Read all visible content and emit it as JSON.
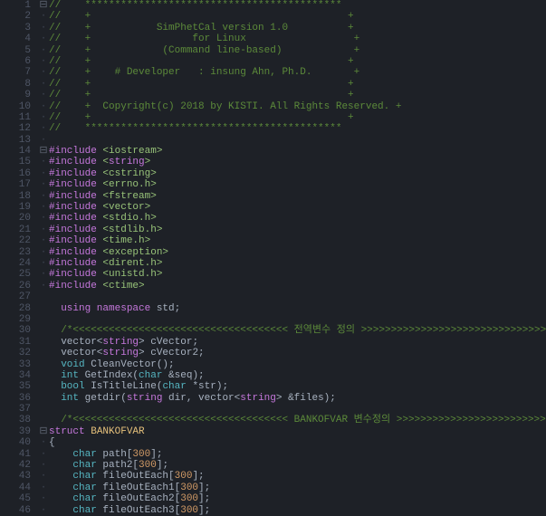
{
  "lines": [
    {
      "n": 1,
      "fold": "⊟",
      "guide": "",
      "tokens": [
        {
          "t": "//    *******************************************",
          "c": "c-comment"
        }
      ]
    },
    {
      "n": 2,
      "fold": "",
      "guide": "|",
      "tokens": [
        {
          "t": "//    +                                           +",
          "c": "c-comment"
        }
      ]
    },
    {
      "n": 3,
      "fold": "",
      "guide": "|",
      "tokens": [
        {
          "t": "//    +           SimPhetCal version 1.0          +",
          "c": "c-comment"
        }
      ]
    },
    {
      "n": 4,
      "fold": "",
      "guide": "|",
      "tokens": [
        {
          "t": "//    +                 for Linux                  +",
          "c": "c-comment"
        }
      ]
    },
    {
      "n": 5,
      "fold": "",
      "guide": "|",
      "tokens": [
        {
          "t": "//    +            (Command line-based)            +",
          "c": "c-comment"
        }
      ]
    },
    {
      "n": 6,
      "fold": "",
      "guide": "|",
      "tokens": [
        {
          "t": "//    +                                           +",
          "c": "c-comment"
        }
      ]
    },
    {
      "n": 7,
      "fold": "",
      "guide": "|",
      "tokens": [
        {
          "t": "//    +    # Developer   : insung Ahn, Ph.D.       +",
          "c": "c-comment"
        }
      ]
    },
    {
      "n": 8,
      "fold": "",
      "guide": "|",
      "tokens": [
        {
          "t": "//    +                                           +",
          "c": "c-comment"
        }
      ]
    },
    {
      "n": 9,
      "fold": "",
      "guide": "|",
      "tokens": [
        {
          "t": "//    +                                           +",
          "c": "c-comment"
        }
      ]
    },
    {
      "n": 10,
      "fold": "",
      "guide": "|",
      "tokens": [
        {
          "t": "//    +  Copyright(c) 2018 by KISTI. All Rights Reserved. +",
          "c": "c-comment"
        }
      ]
    },
    {
      "n": 11,
      "fold": "",
      "guide": "|",
      "tokens": [
        {
          "t": "//    +                                           +",
          "c": "c-comment"
        }
      ]
    },
    {
      "n": 12,
      "fold": "",
      "guide": "|",
      "tokens": [
        {
          "t": "//    *******************************************",
          "c": "c-comment"
        }
      ]
    },
    {
      "n": 13,
      "fold": "",
      "guide": "|",
      "tokens": []
    },
    {
      "n": 14,
      "fold": "⊟",
      "guide": "",
      "tokens": [
        {
          "t": "#include ",
          "c": "c-pp"
        },
        {
          "t": "<iostream>",
          "c": "c-str"
        }
      ]
    },
    {
      "n": 15,
      "fold": "",
      "guide": "|",
      "tokens": [
        {
          "t": "#include ",
          "c": "c-pp"
        },
        {
          "t": "<",
          "c": "c-str"
        },
        {
          "t": "string",
          "c": "c-kw"
        },
        {
          "t": ">",
          "c": "c-str"
        }
      ]
    },
    {
      "n": 16,
      "fold": "",
      "guide": "|",
      "tokens": [
        {
          "t": "#include ",
          "c": "c-pp"
        },
        {
          "t": "<cstring>",
          "c": "c-str"
        }
      ]
    },
    {
      "n": 17,
      "fold": "",
      "guide": "|",
      "tokens": [
        {
          "t": "#include ",
          "c": "c-pp"
        },
        {
          "t": "<errno.h>",
          "c": "c-str"
        }
      ]
    },
    {
      "n": 18,
      "fold": "",
      "guide": "|",
      "tokens": [
        {
          "t": "#include ",
          "c": "c-pp"
        },
        {
          "t": "<fstream>",
          "c": "c-str"
        }
      ]
    },
    {
      "n": 19,
      "fold": "",
      "guide": "|",
      "tokens": [
        {
          "t": "#include ",
          "c": "c-pp"
        },
        {
          "t": "<vector>",
          "c": "c-str"
        }
      ]
    },
    {
      "n": 20,
      "fold": "",
      "guide": "|",
      "tokens": [
        {
          "t": "#include ",
          "c": "c-pp"
        },
        {
          "t": "<stdio.h>",
          "c": "c-str"
        }
      ]
    },
    {
      "n": 21,
      "fold": "",
      "guide": "|",
      "tokens": [
        {
          "t": "#include ",
          "c": "c-pp"
        },
        {
          "t": "<stdlib.h>",
          "c": "c-str"
        }
      ]
    },
    {
      "n": 22,
      "fold": "",
      "guide": "|",
      "tokens": [
        {
          "t": "#include ",
          "c": "c-pp"
        },
        {
          "t": "<time.h>",
          "c": "c-str"
        }
      ]
    },
    {
      "n": 23,
      "fold": "",
      "guide": "|",
      "tokens": [
        {
          "t": "#include ",
          "c": "c-pp"
        },
        {
          "t": "<exception>",
          "c": "c-str"
        }
      ]
    },
    {
      "n": 24,
      "fold": "",
      "guide": "|",
      "tokens": [
        {
          "t": "#include ",
          "c": "c-pp"
        },
        {
          "t": "<dirent.h>",
          "c": "c-str"
        }
      ]
    },
    {
      "n": 25,
      "fold": "",
      "guide": "|",
      "tokens": [
        {
          "t": "#include ",
          "c": "c-pp"
        },
        {
          "t": "<unistd.h>",
          "c": "c-str"
        }
      ]
    },
    {
      "n": 26,
      "fold": "",
      "guide": "|",
      "tokens": [
        {
          "t": "#include ",
          "c": "c-pp"
        },
        {
          "t": "<ctime>",
          "c": "c-str"
        }
      ]
    },
    {
      "n": 27,
      "fold": "",
      "guide": "",
      "tokens": []
    },
    {
      "n": 28,
      "fold": "",
      "guide": "",
      "tokens": [
        {
          "t": "  ",
          "c": ""
        },
        {
          "t": "using namespace",
          "c": "c-kw"
        },
        {
          "t": " std;",
          "c": "c-ident"
        }
      ]
    },
    {
      "n": 29,
      "fold": "",
      "guide": "",
      "tokens": []
    },
    {
      "n": 30,
      "fold": "",
      "guide": "",
      "tokens": [
        {
          "t": "  ",
          "c": ""
        },
        {
          "t": "/*<<<<<<<<<<<<<<<<<<<<<<<<<<<<<<<<<<<< 전역변수 정의 >>>>>>>>>>>>>>>>>>>>>>>>>>>>>>>>>>>>*/",
          "c": "c-comment"
        }
      ]
    },
    {
      "n": 31,
      "fold": "",
      "guide": "",
      "tokens": [
        {
          "t": "  vector<",
          "c": "c-ident"
        },
        {
          "t": "string",
          "c": "c-kw"
        },
        {
          "t": "> cVector;",
          "c": "c-ident"
        }
      ]
    },
    {
      "n": 32,
      "fold": "",
      "guide": "",
      "tokens": [
        {
          "t": "  vector<",
          "c": "c-ident"
        },
        {
          "t": "string",
          "c": "c-kw"
        },
        {
          "t": "> cVector2;",
          "c": "c-ident"
        }
      ]
    },
    {
      "n": 33,
      "fold": "",
      "guide": "",
      "tokens": [
        {
          "t": "  ",
          "c": ""
        },
        {
          "t": "void",
          "c": "c-type"
        },
        {
          "t": " CleanVector();",
          "c": "c-ident"
        }
      ]
    },
    {
      "n": 34,
      "fold": "",
      "guide": "",
      "tokens": [
        {
          "t": "  ",
          "c": ""
        },
        {
          "t": "int",
          "c": "c-type"
        },
        {
          "t": " GetIndex(",
          "c": "c-ident"
        },
        {
          "t": "char",
          "c": "c-type"
        },
        {
          "t": " &seq);",
          "c": "c-ident"
        }
      ]
    },
    {
      "n": 35,
      "fold": "",
      "guide": "",
      "tokens": [
        {
          "t": "  ",
          "c": ""
        },
        {
          "t": "bool",
          "c": "c-type"
        },
        {
          "t": " IsTitleLine(",
          "c": "c-ident"
        },
        {
          "t": "char",
          "c": "c-type"
        },
        {
          "t": " *str);",
          "c": "c-ident"
        }
      ]
    },
    {
      "n": 36,
      "fold": "",
      "guide": "",
      "tokens": [
        {
          "t": "  ",
          "c": ""
        },
        {
          "t": "int",
          "c": "c-type"
        },
        {
          "t": " getdir(",
          "c": "c-ident"
        },
        {
          "t": "string",
          "c": "c-kw"
        },
        {
          "t": " dir, vector<",
          "c": "c-ident"
        },
        {
          "t": "string",
          "c": "c-kw"
        },
        {
          "t": "> &files);",
          "c": "c-ident"
        }
      ]
    },
    {
      "n": 37,
      "fold": "",
      "guide": "",
      "tokens": []
    },
    {
      "n": 38,
      "fold": "",
      "guide": "",
      "tokens": [
        {
          "t": "  ",
          "c": ""
        },
        {
          "t": "/*<<<<<<<<<<<<<<<<<<<<<<<<<<<<<<<<<<<< BANKOFVAR 변수정의 >>>>>>>>>>>>>>>>>>>>>>>>>>>>>>>>>>>>*/",
          "c": "c-comment"
        }
      ]
    },
    {
      "n": 39,
      "fold": "⊟",
      "guide": "",
      "tokens": [
        {
          "t": "struct",
          "c": "c-kw"
        },
        {
          "t": " ",
          "c": ""
        },
        {
          "t": "BANKOFVAR",
          "c": "c-name"
        }
      ]
    },
    {
      "n": 40,
      "fold": "",
      "guide": "|",
      "tokens": [
        {
          "t": "{",
          "c": "c-punc"
        }
      ]
    },
    {
      "n": 41,
      "fold": "",
      "guide": "|",
      "tokens": [
        {
          "t": "    ",
          "c": ""
        },
        {
          "t": "char",
          "c": "c-type"
        },
        {
          "t": " path[",
          "c": "c-ident"
        },
        {
          "t": "300",
          "c": "c-num"
        },
        {
          "t": "];",
          "c": "c-ident"
        }
      ]
    },
    {
      "n": 42,
      "fold": "",
      "guide": "|",
      "tokens": [
        {
          "t": "    ",
          "c": ""
        },
        {
          "t": "char",
          "c": "c-type"
        },
        {
          "t": " path2[",
          "c": "c-ident"
        },
        {
          "t": "300",
          "c": "c-num"
        },
        {
          "t": "];",
          "c": "c-ident"
        }
      ]
    },
    {
      "n": 43,
      "fold": "",
      "guide": "|",
      "tokens": [
        {
          "t": "    ",
          "c": ""
        },
        {
          "t": "char",
          "c": "c-type"
        },
        {
          "t": " fileOutEach[",
          "c": "c-ident"
        },
        {
          "t": "300",
          "c": "c-num"
        },
        {
          "t": "];",
          "c": "c-ident"
        }
      ]
    },
    {
      "n": 44,
      "fold": "",
      "guide": "|",
      "tokens": [
        {
          "t": "    ",
          "c": ""
        },
        {
          "t": "char",
          "c": "c-type"
        },
        {
          "t": " fileOutEach1[",
          "c": "c-ident"
        },
        {
          "t": "300",
          "c": "c-num"
        },
        {
          "t": "];",
          "c": "c-ident"
        }
      ]
    },
    {
      "n": 45,
      "fold": "",
      "guide": "|",
      "tokens": [
        {
          "t": "    ",
          "c": ""
        },
        {
          "t": "char",
          "c": "c-type"
        },
        {
          "t": " fileOutEach2[",
          "c": "c-ident"
        },
        {
          "t": "300",
          "c": "c-num"
        },
        {
          "t": "];",
          "c": "c-ident"
        }
      ]
    },
    {
      "n": 46,
      "fold": "",
      "guide": "|",
      "tokens": [
        {
          "t": "    ",
          "c": ""
        },
        {
          "t": "char",
          "c": "c-type"
        },
        {
          "t": " fileOutEach3[",
          "c": "c-ident"
        },
        {
          "t": "300",
          "c": "c-num"
        },
        {
          "t": "];",
          "c": "c-ident"
        }
      ]
    }
  ]
}
